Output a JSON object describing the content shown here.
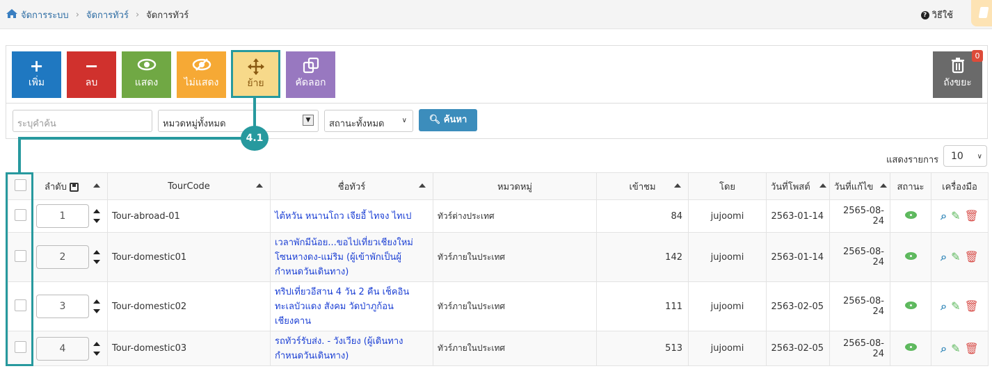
{
  "breadcrumb": {
    "items": [
      "จัดการระบบ",
      "จัดการทัวร์"
    ],
    "current": "จัดการทัวร์"
  },
  "header": {
    "help_label": "วิธีใช้"
  },
  "toolbar": {
    "add": "เพิ่ม",
    "delete": "ลบ",
    "show": "แสดง",
    "hide": "ไม่แสดง",
    "move": "ย้าย",
    "copy": "คัดลอก",
    "trash": "ถังขยะ",
    "trash_count": "0"
  },
  "filters": {
    "search_placeholder": "ระบุคำค้น",
    "category_value": "หมวดหมู่ทั้งหมด",
    "status_value": "สถานะทั้งหมด",
    "search_button": "ค้นหา"
  },
  "callout": {
    "label": "4.1"
  },
  "list_length": {
    "label": "แสดงรายการ",
    "value": "10"
  },
  "table": {
    "headers": {
      "order": "ลำดับ",
      "code": "TourCode",
      "name": "ชื่อทัวร์",
      "category": "หมวดหมู่",
      "views": "เข้าชม",
      "by": "โดย",
      "posted": "วันที่โพสต์",
      "edited": "วันที่แก้ไข",
      "status": "สถานะ",
      "tools": "เครื่องมือ"
    },
    "rows": [
      {
        "order": "1",
        "code": "Tour-abroad-01",
        "name": "ไต้หวัน หนานโถว เจียอี้ ไทจง ไทเป",
        "category": "ทัวร์ต่างประเทศ",
        "views": "84",
        "by": "jujoomi",
        "posted": "2563-01-14",
        "edited": "2565-08-24"
      },
      {
        "order": "2",
        "code": "Tour-domestic01",
        "name": "เวลาพักมีน้อย...ขอไปเที่ยวเชียงใหม่ โซนหางดง-แม่ริม (ผู้เข้าพักเป็นผู้กำหนดวันเดินทาง)",
        "category": "ทัวร์ภายในประเทศ",
        "views": "142",
        "by": "jujoomi",
        "posted": "2563-01-14",
        "edited": "2565-08-24"
      },
      {
        "order": "3",
        "code": "Tour-domestic02",
        "name": "ทริปเที่ยวอีสาน 4 วัน 2 คืน เช็คอินทะเลบัวแดง สังคม วัดป่าภูก้อน เชียงคาน",
        "category": "ทัวร์ภายในประเทศ",
        "views": "111",
        "by": "jujoomi",
        "posted": "2563-02-05",
        "edited": "2565-08-24"
      },
      {
        "order": "4",
        "code": "Tour-domestic03",
        "name": "รถทัวร์รับส่ง. - วังเวียง (ผู้เดินทางกำหนดวันเดินทาง)",
        "category": "ทัวร์ภายในประเทศ",
        "views": "513",
        "by": "jujoomi",
        "posted": "2563-02-05",
        "edited": "2565-08-24"
      }
    ]
  },
  "colors": {
    "add": "#1f78c1",
    "delete": "#d0312d",
    "show": "#70a844",
    "hide": "#f6a935",
    "move": "#f7d98a",
    "copy": "#9878c0",
    "trash": "#6a6a6a",
    "accent": "#27999e"
  }
}
